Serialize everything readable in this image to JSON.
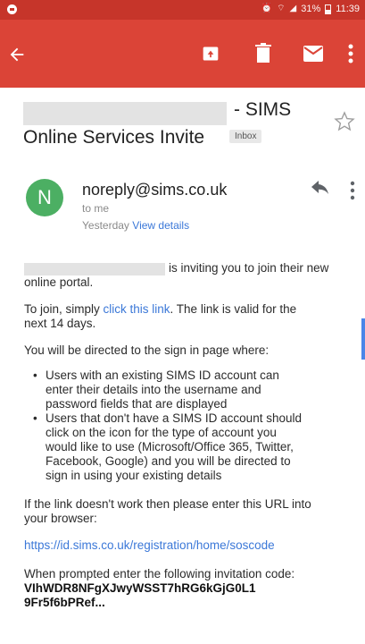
{
  "status_bar": {
    "battery_percent": "31%",
    "time": "11:39",
    "bg_color": "#c6352a"
  },
  "app_bar": {
    "bg_color": "#db4437",
    "icons": [
      "back-arrow-icon",
      "archive-icon",
      "trash-icon",
      "mark-unread-icon",
      "more-vert-icon"
    ]
  },
  "email": {
    "subject_suffix": "- SIMS",
    "subject_line2": "Online Services Invite",
    "label_badge": "Inbox",
    "sender_initial": "N",
    "sender": "noreply@sims.co.uk",
    "to": "to me",
    "date": "Yesterday",
    "view_details": "View details",
    "avatar_color": "#4caf63"
  },
  "body": {
    "p1_line1_tail": "is inviting you to join their new",
    "p1_line2": "online portal.",
    "p2_line1_pre": "To join, simply ",
    "p2_link": "click this link",
    "p2_line1_post": ". The link is valid for the",
    "p2_line2": "next 14 days.",
    "p3": "You will be directed to the sign in page where:",
    "bullet1_lines": [
      "Users with an existing SIMS ID account can",
      "enter their details into the username and",
      "password fields that are displayed"
    ],
    "bullet2_lines": [
      "Users that don't have a SIMS ID account should",
      "click on the icon for the type of account you",
      "would like to use (Microsoft/Office 365, Twitter,",
      "Facebook, Google) and you will be directed to",
      "sign in using your existing details"
    ],
    "p4_line1": "If the link doesn't work then please enter this URL into",
    "p4_line2": "your browser:",
    "url": "https://id.sims.co.uk/registration/home/soscode",
    "p5_line1": "When prompted enter the following invitation code:",
    "code_line1": "VIhWDR8NFgXJwyWSST7hRG6kGjG0L1",
    "code_line2": "9Fr5f6bPRef..."
  }
}
